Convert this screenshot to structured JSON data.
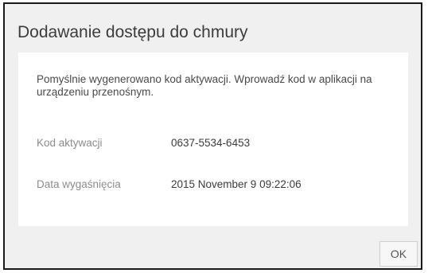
{
  "dialog": {
    "title": "Dodawanie dostępu do chmury",
    "message": "Pomyślnie wygenerowano kod aktywacji. Wprowadź kod w aplikacji na urządzeniu przenośnym.",
    "fields": [
      {
        "label": "Kod aktywacji",
        "value": "0637-5534-6453"
      },
      {
        "label": "Data wygaśnięcia",
        "value": "2015 November 9 09:22:06"
      }
    ],
    "ok_label": "OK"
  },
  "colors": {
    "background": "#f0f0f0",
    "panel": "#ffffff",
    "border": "#1a1a1a"
  }
}
